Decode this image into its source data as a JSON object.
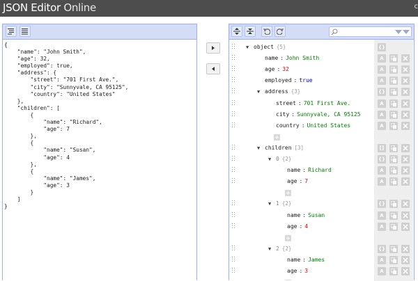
{
  "app": {
    "title_part1": "JSON Editor",
    "title_part2": "Online",
    "header_corner": "c"
  },
  "left_panel": {
    "code_lines": [
      "{",
      "    \"name\": \"John Smith\",",
      "    \"age\": 32,",
      "    \"employed\": true,",
      "    \"address\": {",
      "        \"street\": \"701 First Ave.\",",
      "        \"city\": \"Sunnyvale, CA 95125\",",
      "        \"country\": \"United States\"",
      "    },",
      "    \"children\": [",
      "        {",
      "            \"name\": \"Richard\",",
      "            \"age\": 7",
      "        },",
      "        {",
      "            \"name\": \"Susan\",",
      "            \"age\": 4",
      "        },",
      "        {",
      "            \"name\": \"James\",",
      "            \"age\": 3",
      "        }",
      "    ]",
      "}"
    ]
  },
  "splitter": {
    "to_right_icon": "arrow-right-icon",
    "to_left_icon": "arrow-left-icon"
  },
  "right_panel": {
    "search": {
      "placeholder": "",
      "value": ""
    },
    "menu_icons": [
      "expand-all-icon",
      "collapse-all-icon",
      "undo-icon",
      "redo-icon"
    ],
    "tree": [
      {
        "key": "object",
        "count": "{5}",
        "toggle": "▼",
        "level": 0,
        "row": 0,
        "actions": [
          "object-type-icon"
        ]
      },
      {
        "key": "name",
        "value": "John Smith",
        "vtype": "string",
        "level": 1,
        "row": 1,
        "actions": [
          "string-type-icon",
          "duplicate-icon",
          "remove-icon"
        ]
      },
      {
        "key": "age",
        "value": "32",
        "vtype": "number",
        "level": 1,
        "row": 2,
        "actions": [
          "string-type-icon",
          "duplicate-icon",
          "remove-icon"
        ]
      },
      {
        "key": "employed",
        "value": "true",
        "vtype": "boolean",
        "level": 1,
        "row": 3,
        "actions": [
          "string-type-icon",
          "duplicate-icon",
          "remove-icon"
        ]
      },
      {
        "key": "address",
        "count": "{3}",
        "toggle": "▼",
        "level": 1,
        "row": 4,
        "actions": [
          "object-type-icon",
          "duplicate-icon",
          "remove-icon"
        ]
      },
      {
        "key": "street",
        "value": "701 First Ave.",
        "vtype": "string",
        "level": 2,
        "row": 5,
        "actions": [
          "string-type-icon",
          "duplicate-icon",
          "remove-icon"
        ]
      },
      {
        "key": "city",
        "value": "Sunnyvale, CA 95125",
        "vtype": "string",
        "level": 2,
        "row": 6,
        "actions": [
          "string-type-icon",
          "duplicate-icon",
          "remove-icon"
        ]
      },
      {
        "key": "country",
        "value": "United States",
        "vtype": "string",
        "level": 2,
        "row": 7,
        "actions": [
          "string-type-icon",
          "duplicate-icon",
          "remove-icon"
        ]
      },
      {
        "add": true,
        "level": 2,
        "row": 8
      },
      {
        "key": "children",
        "count": "[3]",
        "toggle": "▼",
        "level": 1,
        "row": 9,
        "actions": [
          "array-type-icon",
          "duplicate-icon",
          "remove-icon"
        ]
      },
      {
        "key": "0",
        "count": "{2}",
        "toggle": "▼",
        "level": 2,
        "row": 10,
        "index": true,
        "actions": [
          "object-type-icon",
          "duplicate-icon",
          "remove-icon"
        ]
      },
      {
        "key": "name",
        "value": "Richard",
        "vtype": "string",
        "level": 3,
        "row": 11,
        "actions": [
          "string-type-icon",
          "duplicate-icon",
          "remove-icon"
        ]
      },
      {
        "key": "age",
        "value": "7",
        "vtype": "number",
        "level": 3,
        "row": 12,
        "actions": [
          "string-type-icon",
          "duplicate-icon",
          "remove-icon"
        ]
      },
      {
        "add": true,
        "level": 3,
        "row": 13
      },
      {
        "key": "1",
        "count": "{2}",
        "toggle": "▼",
        "level": 2,
        "row": 14,
        "index": true,
        "actions": [
          "object-type-icon",
          "duplicate-icon",
          "remove-icon"
        ]
      },
      {
        "key": "name",
        "value": "Susan",
        "vtype": "string",
        "level": 3,
        "row": 15,
        "actions": [
          "string-type-icon",
          "duplicate-icon",
          "remove-icon"
        ]
      },
      {
        "key": "age",
        "value": "4",
        "vtype": "number",
        "level": 3,
        "row": 16,
        "actions": [
          "string-type-icon",
          "duplicate-icon",
          "remove-icon"
        ]
      },
      {
        "add": true,
        "level": 3,
        "row": 17
      },
      {
        "key": "2",
        "count": "{2}",
        "toggle": "▼",
        "level": 2,
        "row": 18,
        "index": true,
        "actions": [
          "object-type-icon",
          "duplicate-icon",
          "remove-icon"
        ]
      },
      {
        "key": "name",
        "value": "James",
        "vtype": "string",
        "level": 3,
        "row": 19,
        "actions": [
          "string-type-icon",
          "duplicate-icon",
          "remove-icon"
        ]
      },
      {
        "key": "age",
        "value": "3",
        "vtype": "number",
        "level": 3,
        "row": 20,
        "actions": [
          "string-type-icon",
          "duplicate-icon",
          "remove-icon"
        ]
      },
      {
        "add": true,
        "level": 3,
        "row": 21
      }
    ]
  },
  "colors": {
    "header": "#4d4d4d",
    "panel_border": "#97b0f8",
    "menu": "#d5ddf6",
    "string": "#008000",
    "number": "#ee0000",
    "boolean": "#0000dd",
    "count": "#999999"
  }
}
